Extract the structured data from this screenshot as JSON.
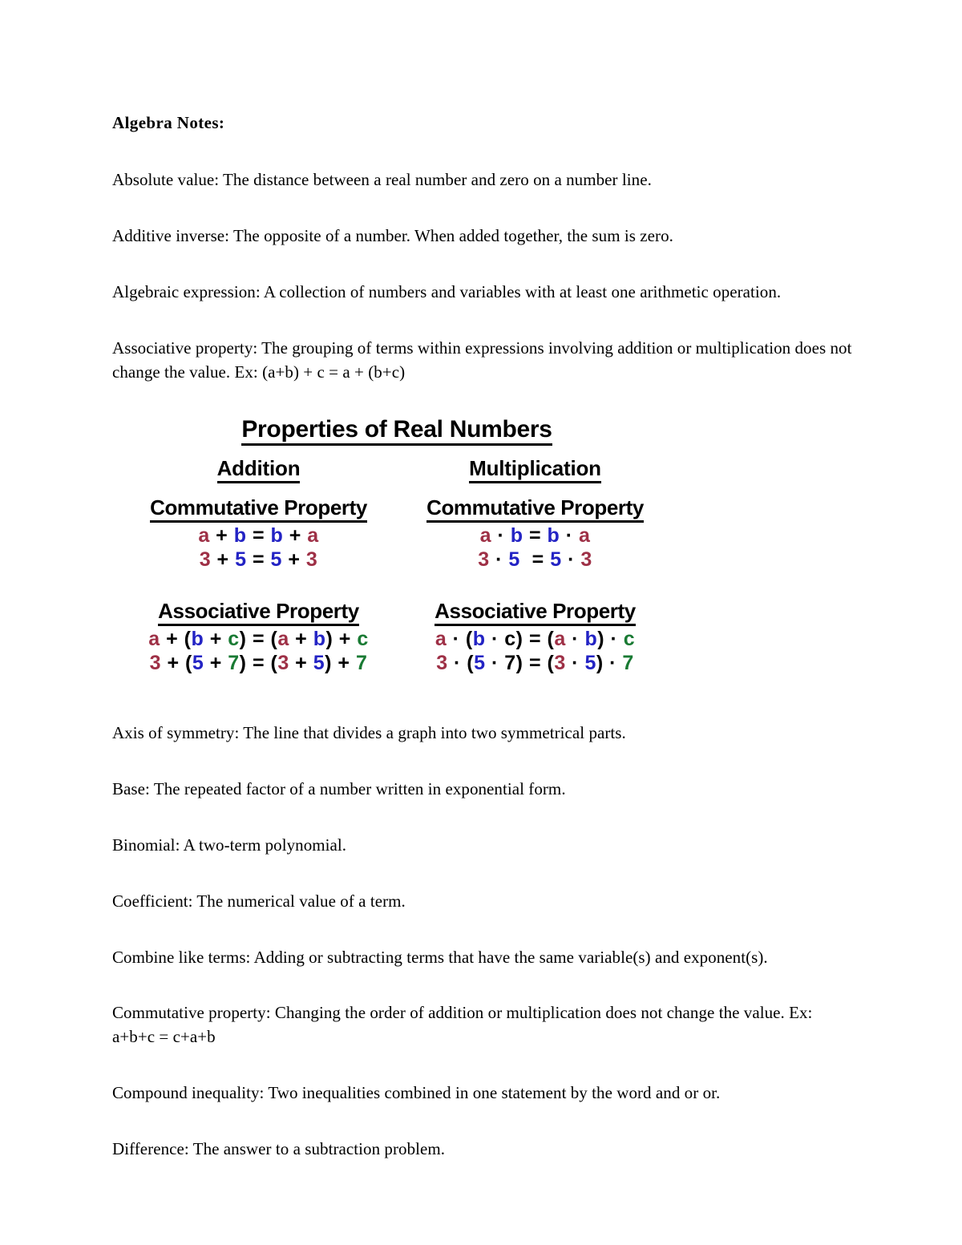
{
  "document": {
    "title": "Algebra Notes:",
    "entries": [
      {
        "id": "absolute-value",
        "text": "Absolute value: The distance between a real number and zero on a number line."
      },
      {
        "id": "additive-inverse",
        "text": "Additive inverse: The opposite of a number. When added together, the sum is zero."
      },
      {
        "id": "algebraic-expression",
        "text": "Algebraic expression: A collection of numbers and variables with at least one arithmetic operation."
      },
      {
        "id": "associative-property",
        "text": "Associative property: The grouping of terms within expressions involving addition or multiplication does not change the value. Ex: (a+b) + c = a + (b+c)"
      }
    ],
    "entries_after_figure": [
      {
        "id": "axis-of-symmetry",
        "text": "Axis of symmetry: The line that divides a graph into two symmetrical parts."
      },
      {
        "id": "base",
        "text": "Base: The repeated factor of a number written in exponential form."
      },
      {
        "id": "binomial",
        "text": "Binomial: A two-term polynomial."
      },
      {
        "id": "coefficient",
        "text": "Coefficient: The numerical value of a term."
      },
      {
        "id": "combine-like-terms",
        "text": "Combine like terms: Adding or subtracting terms that have the same variable(s) and exponent(s)."
      },
      {
        "id": "commutative-property",
        "text": "Commutative property: Changing the order of addition or multiplication does not change the value. Ex: a+b+c = c+a+b"
      },
      {
        "id": "compound-inequality",
        "text": "Compound inequality: Two inequalities combined in one statement by the word and or or."
      },
      {
        "id": "difference",
        "text": "Difference: The answer to a subtraction problem."
      }
    ]
  },
  "figure": {
    "title": "Properties of Real Numbers",
    "colors": {
      "variable_a": "#9E3046",
      "variable_b": "#2323C4",
      "variable_c": "#197A33",
      "operator": "#000000"
    },
    "columns": [
      {
        "heading": "Addition",
        "properties": [
          {
            "name": "Commutative Property",
            "lines": [
              {
                "tokens": [
                  {
                    "text": "a",
                    "color": "a"
                  },
                  {
                    "text": " + ",
                    "color": "op"
                  },
                  {
                    "text": "b",
                    "color": "b"
                  },
                  {
                    "text": " = ",
                    "color": "op"
                  },
                  {
                    "text": "b",
                    "color": "b"
                  },
                  {
                    "text": " + ",
                    "color": "op"
                  },
                  {
                    "text": "a",
                    "color": "a"
                  }
                ]
              },
              {
                "tokens": [
                  {
                    "text": "3",
                    "color": "a"
                  },
                  {
                    "text": " + ",
                    "color": "op"
                  },
                  {
                    "text": "5",
                    "color": "b"
                  },
                  {
                    "text": " = ",
                    "color": "op"
                  },
                  {
                    "text": "5",
                    "color": "b"
                  },
                  {
                    "text": " + ",
                    "color": "op"
                  },
                  {
                    "text": "3",
                    "color": "a"
                  }
                ]
              }
            ]
          },
          {
            "name": "Associative Property",
            "lines": [
              {
                "tokens": [
                  {
                    "text": "a",
                    "color": "a"
                  },
                  {
                    "text": " + (",
                    "color": "op"
                  },
                  {
                    "text": "b",
                    "color": "b"
                  },
                  {
                    "text": " + ",
                    "color": "op"
                  },
                  {
                    "text": "c",
                    "color": "c"
                  },
                  {
                    "text": ") = (",
                    "color": "op"
                  },
                  {
                    "text": "a",
                    "color": "a"
                  },
                  {
                    "text": " + ",
                    "color": "op"
                  },
                  {
                    "text": "b",
                    "color": "b"
                  },
                  {
                    "text": ") + ",
                    "color": "op"
                  },
                  {
                    "text": "c",
                    "color": "c"
                  }
                ]
              },
              {
                "tokens": [
                  {
                    "text": "3",
                    "color": "a"
                  },
                  {
                    "text": " + (",
                    "color": "op"
                  },
                  {
                    "text": "5",
                    "color": "b"
                  },
                  {
                    "text": " + ",
                    "color": "op"
                  },
                  {
                    "text": "7",
                    "color": "c"
                  },
                  {
                    "text": ") = (",
                    "color": "op"
                  },
                  {
                    "text": "3",
                    "color": "a"
                  },
                  {
                    "text": " + ",
                    "color": "op"
                  },
                  {
                    "text": "5",
                    "color": "b"
                  },
                  {
                    "text": ") + ",
                    "color": "op"
                  },
                  {
                    "text": "7",
                    "color": "c"
                  }
                ]
              }
            ]
          }
        ]
      },
      {
        "heading": "Multiplication",
        "properties": [
          {
            "name": "Commutative Property",
            "lines": [
              {
                "tokens": [
                  {
                    "text": "a",
                    "color": "a"
                  },
                  {
                    "text": " · ",
                    "color": "op"
                  },
                  {
                    "text": "b",
                    "color": "b"
                  },
                  {
                    "text": " = ",
                    "color": "op"
                  },
                  {
                    "text": "b",
                    "color": "b"
                  },
                  {
                    "text": " · ",
                    "color": "op"
                  },
                  {
                    "text": "a",
                    "color": "a"
                  }
                ]
              },
              {
                "tokens": [
                  {
                    "text": "3",
                    "color": "a"
                  },
                  {
                    "text": " · ",
                    "color": "op"
                  },
                  {
                    "text": "5",
                    "color": "b"
                  },
                  {
                    "text": "  = ",
                    "color": "op"
                  },
                  {
                    "text": "5",
                    "color": "b"
                  },
                  {
                    "text": " · ",
                    "color": "op"
                  },
                  {
                    "text": "3",
                    "color": "a"
                  }
                ]
              }
            ]
          },
          {
            "name": "Associative Property",
            "lines": [
              {
                "tokens": [
                  {
                    "text": "a",
                    "color": "a"
                  },
                  {
                    "text": " · (",
                    "color": "op"
                  },
                  {
                    "text": "b",
                    "color": "b"
                  },
                  {
                    "text": " · c) = (",
                    "color": "op"
                  },
                  {
                    "text": "a",
                    "color": "a"
                  },
                  {
                    "text": " · ",
                    "color": "op"
                  },
                  {
                    "text": "b",
                    "color": "b"
                  },
                  {
                    "text": ") · ",
                    "color": "op"
                  },
                  {
                    "text": "c",
                    "color": "c"
                  }
                ]
              },
              {
                "tokens": [
                  {
                    "text": "3",
                    "color": "a"
                  },
                  {
                    "text": " · (",
                    "color": "op"
                  },
                  {
                    "text": "5",
                    "color": "b"
                  },
                  {
                    "text": " · 7) = (",
                    "color": "op"
                  },
                  {
                    "text": "3",
                    "color": "a"
                  },
                  {
                    "text": " · ",
                    "color": "op"
                  },
                  {
                    "text": "5",
                    "color": "b"
                  },
                  {
                    "text": ") · ",
                    "color": "op"
                  },
                  {
                    "text": "7",
                    "color": "c"
                  }
                ]
              }
            ]
          }
        ]
      }
    ]
  }
}
